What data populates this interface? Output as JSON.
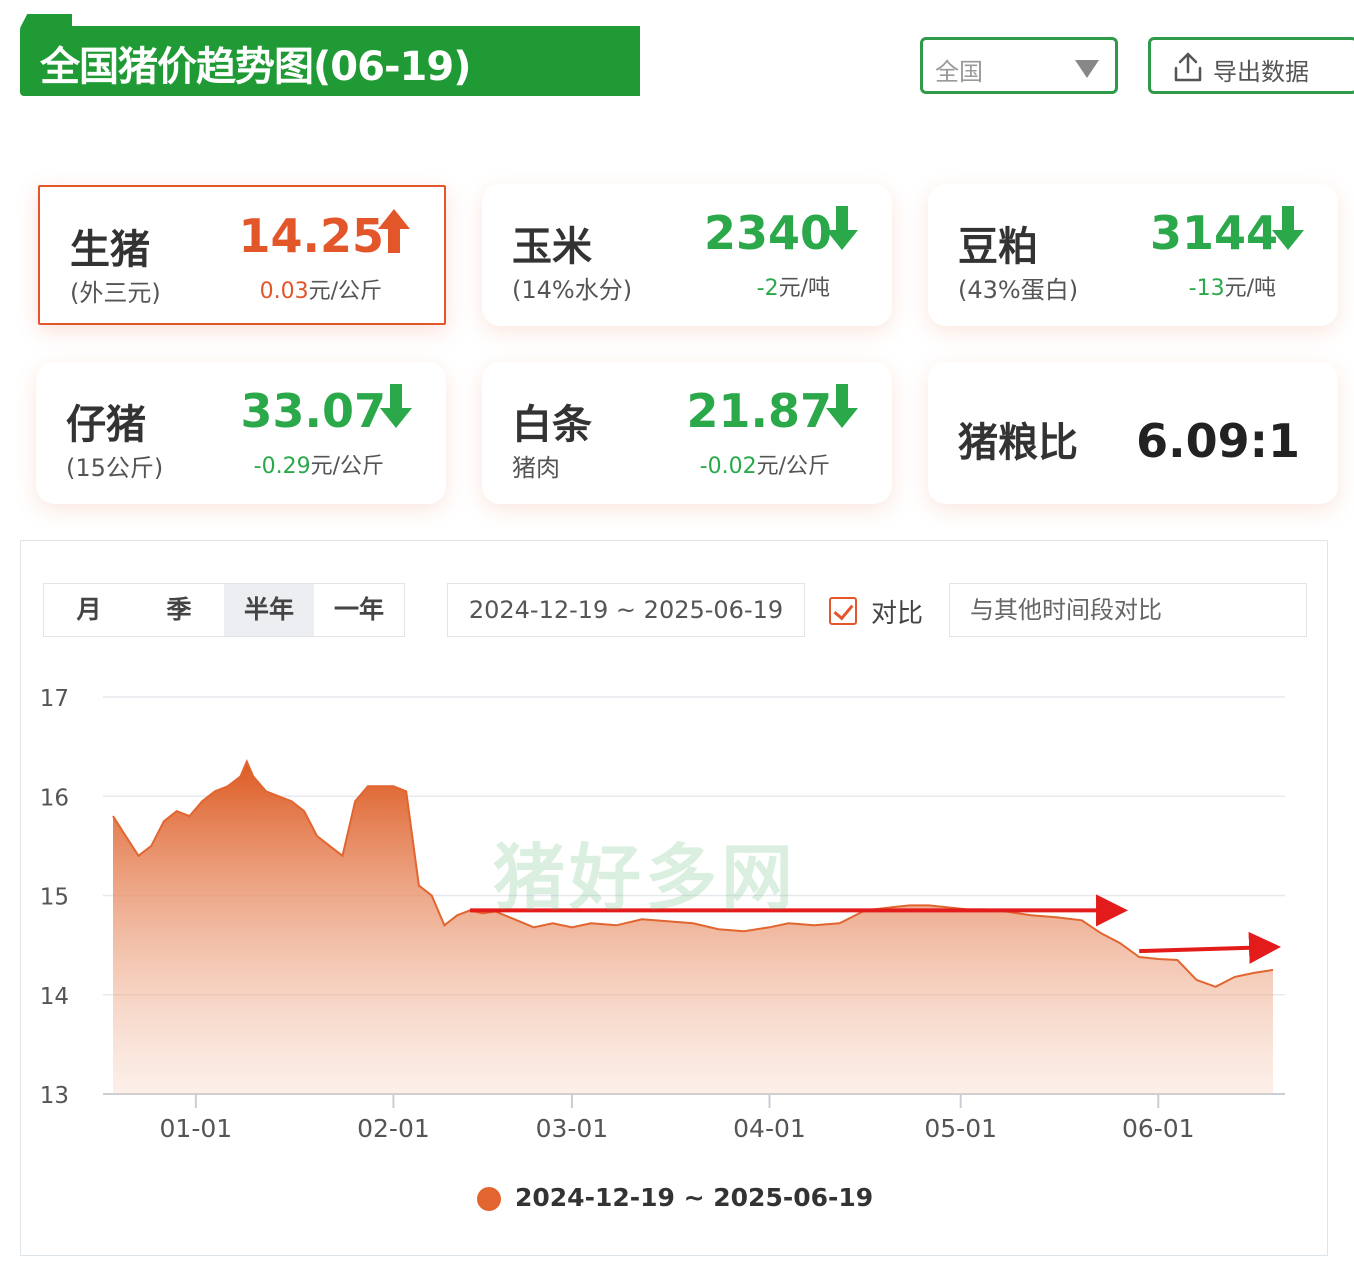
{
  "header": {
    "title": "全国猪价趋势图(06-19)",
    "region_value": "全国",
    "export_label": "导出数据"
  },
  "cards": [
    {
      "name": "生猪",
      "sub": "(外三元)",
      "value": "14.25",
      "direction": "up",
      "change_num": "0.03",
      "change_unit": "元/公斤"
    },
    {
      "name": "玉米",
      "sub": "(14%水分)",
      "value": "2340",
      "direction": "down",
      "change_num": "-2",
      "change_unit": "元/吨"
    },
    {
      "name": "豆粕",
      "sub": "(43%蛋白)",
      "value": "3144",
      "direction": "down",
      "change_num": "-13",
      "change_unit": "元/吨"
    },
    {
      "name": "仔猪",
      "sub": "(15公斤)",
      "value": "33.07",
      "direction": "down",
      "change_num": "-0.29",
      "change_unit": "元/公斤"
    },
    {
      "name": "白条",
      "sub": "猪肉",
      "value": "21.87",
      "direction": "down",
      "change_num": "-0.02",
      "change_unit": "元/公斤"
    },
    {
      "name": "猪粮比",
      "ratio": "6.09:1"
    }
  ],
  "controls": {
    "periods": [
      "月",
      "季",
      "半年",
      "一年"
    ],
    "selected_period": "半年",
    "date_range": "2024-12-19 ~ 2025-06-19",
    "compare_label": "对比",
    "compare_checked": true,
    "compare_placeholder": "与其他时间段对比"
  },
  "watermark": "猪好多网",
  "colors": {
    "up": "#e2562a",
    "down": "#2aa84a",
    "series": "#e2652f",
    "annotation": "#e31b1b",
    "accent": "#1f9a35"
  },
  "chart_data": {
    "type": "area",
    "ylim": [
      13,
      17
    ],
    "yticks": [
      13,
      14,
      15,
      16,
      17
    ],
    "xticks": [
      {
        "label": "01-01",
        "date": "2025-01-01"
      },
      {
        "label": "02-01",
        "date": "2025-02-01"
      },
      {
        "label": "03-01",
        "date": "2025-03-01"
      },
      {
        "label": "04-01",
        "date": "2025-04-01"
      },
      {
        "label": "05-01",
        "date": "2025-05-01"
      },
      {
        "label": "06-01",
        "date": "2025-06-01"
      }
    ],
    "series": [
      {
        "name": "2024-12-19 ~ 2025-06-19",
        "x": [
          "2024-12-19",
          "2024-12-21",
          "2024-12-23",
          "2024-12-25",
          "2024-12-27",
          "2024-12-29",
          "2024-12-31",
          "2025-01-02",
          "2025-01-04",
          "2025-01-06",
          "2025-01-08",
          "2025-01-09",
          "2025-01-10",
          "2025-01-12",
          "2025-01-14",
          "2025-01-16",
          "2025-01-18",
          "2025-01-20",
          "2025-01-22",
          "2025-01-24",
          "2025-01-26",
          "2025-01-28",
          "2025-01-30",
          "2025-02-01",
          "2025-02-03",
          "2025-02-05",
          "2025-02-07",
          "2025-02-09",
          "2025-02-11",
          "2025-02-13",
          "2025-02-15",
          "2025-02-17",
          "2025-02-20",
          "2025-02-23",
          "2025-02-26",
          "2025-03-01",
          "2025-03-04",
          "2025-03-08",
          "2025-03-12",
          "2025-03-16",
          "2025-03-20",
          "2025-03-24",
          "2025-03-28",
          "2025-04-01",
          "2025-04-04",
          "2025-04-08",
          "2025-04-12",
          "2025-04-16",
          "2025-04-20",
          "2025-04-23",
          "2025-04-26",
          "2025-04-29",
          "2025-05-02",
          "2025-05-05",
          "2025-05-08",
          "2025-05-12",
          "2025-05-16",
          "2025-05-20",
          "2025-05-23",
          "2025-05-26",
          "2025-05-29",
          "2025-06-01",
          "2025-06-04",
          "2025-06-07",
          "2025-06-10",
          "2025-06-13",
          "2025-06-16",
          "2025-06-19"
        ],
        "values": [
          15.8,
          15.6,
          15.4,
          15.5,
          15.75,
          15.85,
          15.8,
          15.95,
          16.05,
          16.1,
          16.2,
          16.35,
          16.2,
          16.05,
          16.0,
          15.95,
          15.85,
          15.6,
          15.5,
          15.4,
          15.95,
          16.1,
          16.1,
          16.1,
          16.05,
          15.1,
          15.0,
          14.7,
          14.8,
          14.85,
          14.82,
          14.84,
          14.76,
          14.68,
          14.72,
          14.68,
          14.72,
          14.7,
          14.76,
          14.74,
          14.72,
          14.66,
          14.64,
          14.68,
          14.72,
          14.7,
          14.72,
          14.85,
          14.88,
          14.9,
          14.9,
          14.88,
          14.86,
          14.86,
          14.84,
          14.8,
          14.78,
          14.75,
          14.62,
          14.52,
          14.38,
          14.36,
          14.35,
          14.15,
          14.08,
          14.18,
          14.22,
          14.25
        ]
      }
    ],
    "annotations": [
      {
        "type": "arrow",
        "from": {
          "date": "2025-02-13",
          "value": 14.85
        },
        "to": {
          "date": "2025-05-26",
          "value": 14.85
        }
      },
      {
        "type": "arrow",
        "from": {
          "date": "2025-05-29",
          "value": 14.44
        },
        "to": {
          "date": "2025-06-19",
          "value": 14.48
        }
      }
    ]
  }
}
